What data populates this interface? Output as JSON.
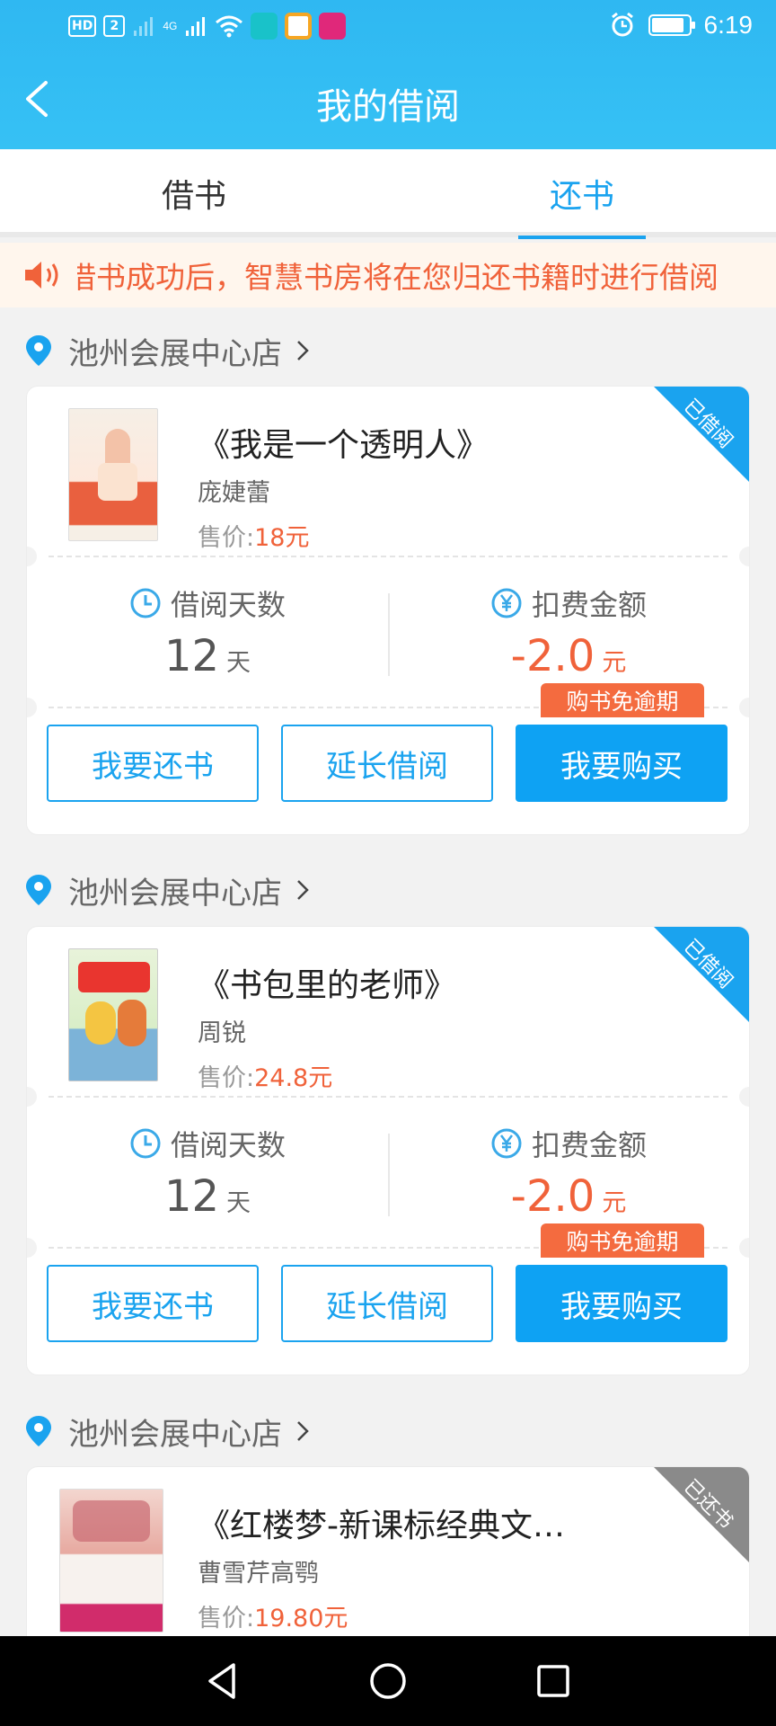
{
  "status_bar": {
    "chips": [
      "HD",
      "2"
    ],
    "network": "4G",
    "time": "6:19"
  },
  "header": {
    "title": "我的借阅"
  },
  "tabs": [
    {
      "label": "借书",
      "active": false
    },
    {
      "label": "还书",
      "active": true
    }
  ],
  "notice": {
    "text": "借书成功后，智慧书房将在您归还书籍时进行借阅"
  },
  "groups": [
    {
      "store": "池州会展中心店",
      "book": {
        "title": "《我是一个透明人》",
        "author": "庞婕蕾",
        "price_label": "售价:",
        "price": "18元",
        "status": "已借阅"
      },
      "days_label": "借阅天数",
      "days": "12",
      "days_unit": "天",
      "fee_label": "扣费金额",
      "fee": "-2.0",
      "fee_unit": "元",
      "promo": "购书免逾期",
      "buttons": {
        "return": "我要还书",
        "extend": "延长借阅",
        "buy": "我要购买"
      }
    },
    {
      "store": "池州会展中心店",
      "book": {
        "title": "《书包里的老师》",
        "author": "周锐",
        "price_label": "售价:",
        "price": "24.8元",
        "status": "已借阅"
      },
      "days_label": "借阅天数",
      "days": "12",
      "days_unit": "天",
      "fee_label": "扣费金额",
      "fee": "-2.0",
      "fee_unit": "元",
      "promo": "购书免逾期",
      "buttons": {
        "return": "我要还书",
        "extend": "延长借阅",
        "buy": "我要购买"
      }
    },
    {
      "store": "池州会展中心店",
      "book": {
        "title": "《红楼梦-新课标经典文…",
        "author": "曹雪芹高鹗",
        "price_label": "售价:",
        "price": "19.80元",
        "status": "已还书"
      }
    }
  ],
  "colors": {
    "header": "#2fb8f2",
    "accent": "#1aa3ef",
    "price": "#f0623a",
    "promo": "#f46b3f",
    "returned_badge": "#8a8a8a"
  }
}
